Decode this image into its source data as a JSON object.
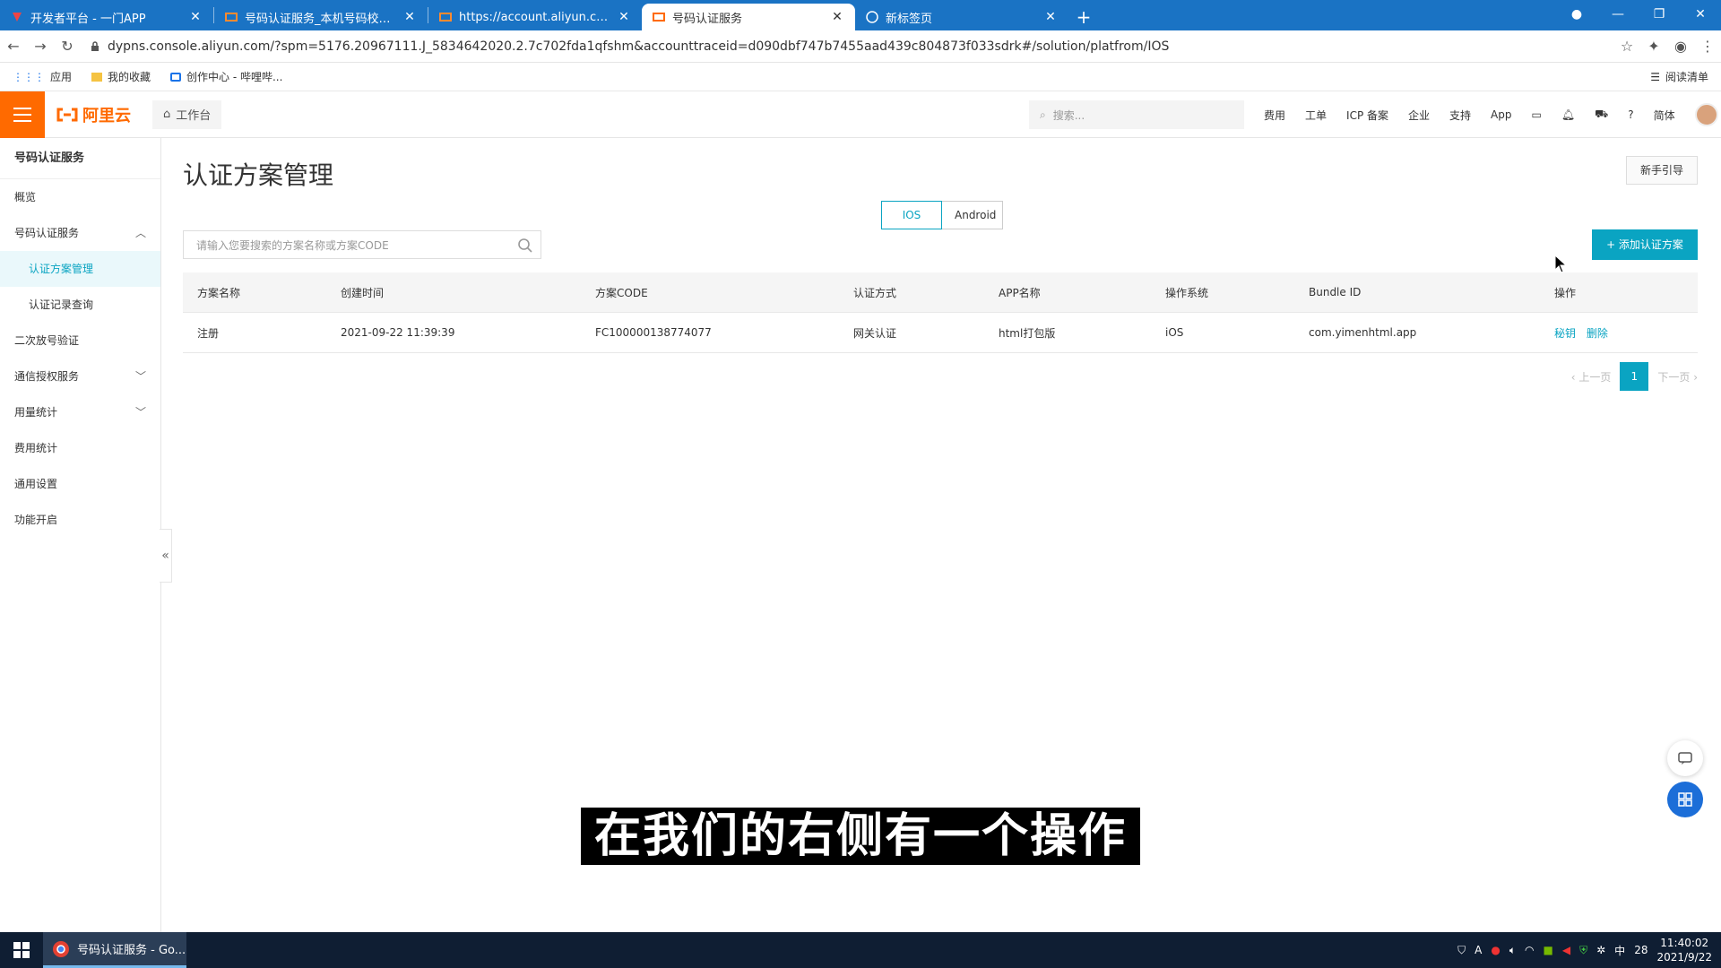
{
  "browser": {
    "tabs": [
      {
        "label": "开发者平台 - 一门APP",
        "active": false
      },
      {
        "label": "号码认证服务_本机号码校验_通信",
        "active": false
      },
      {
        "label": "https://account.aliyun.com/lo",
        "active": false
      },
      {
        "label": "号码认证服务",
        "active": true
      },
      {
        "label": "新标签页",
        "active": false
      }
    ],
    "url": "dypns.console.aliyun.com/?spm=5176.20967111.J_5834642020.2.7c702fda1qfshm&accounttraceid=d090dbf747b7455aad439c804873f033sdrk#/solution/platfrom/IOS",
    "bookmarks": [
      "应用",
      "我的收藏",
      "创作中心 - 哔哩哔..."
    ],
    "reading_list": "阅读清单"
  },
  "header": {
    "logo": "阿里云",
    "workbench": "工作台",
    "search_placeholder": "搜索...",
    "nav": [
      "费用",
      "工单",
      "ICP 备案",
      "企业",
      "支持",
      "App"
    ],
    "lang": "简体"
  },
  "sidebar": {
    "title": "号码认证服务",
    "items": [
      {
        "label": "概览"
      },
      {
        "label": "号码认证服务",
        "chevron": "up"
      },
      {
        "label": "认证方案管理",
        "sub": true,
        "active": true
      },
      {
        "label": "认证记录查询",
        "sub": true
      },
      {
        "label": "二次放号验证"
      },
      {
        "label": "通信授权服务",
        "chevron": "down"
      },
      {
        "label": "用量统计",
        "chevron": "down"
      },
      {
        "label": "费用统计"
      },
      {
        "label": "通用设置"
      },
      {
        "label": "功能开启"
      }
    ]
  },
  "main": {
    "title": "认证方案管理",
    "guide": "新手引导",
    "platform_tabs": [
      "IOS",
      "Android"
    ],
    "search_placeholder": "请输入您要搜索的方案名称或方案CODE",
    "add_button": "+ 添加认证方案",
    "table": {
      "headers": [
        "方案名称",
        "创建时间",
        "方案CODE",
        "认证方式",
        "APP名称",
        "操作系统",
        "Bundle ID",
        "操作"
      ],
      "rows": [
        [
          "注册",
          "2021-09-22 11:39:39",
          "FC100000138774077",
          "网关认证",
          "html打包版",
          "iOS",
          "com.yimenhtml.app"
        ]
      ],
      "actions": [
        "秘钥",
        "删除"
      ]
    },
    "pager": {
      "prev": "上一页",
      "page": "1",
      "next": "下一页"
    }
  },
  "subtitle": "在我们的右侧有一个操作",
  "taskbar": {
    "app": "号码认证服务 - Go...",
    "ime": "中",
    "temp": "28",
    "time": "11:40:02",
    "date": "2021/9/22"
  }
}
